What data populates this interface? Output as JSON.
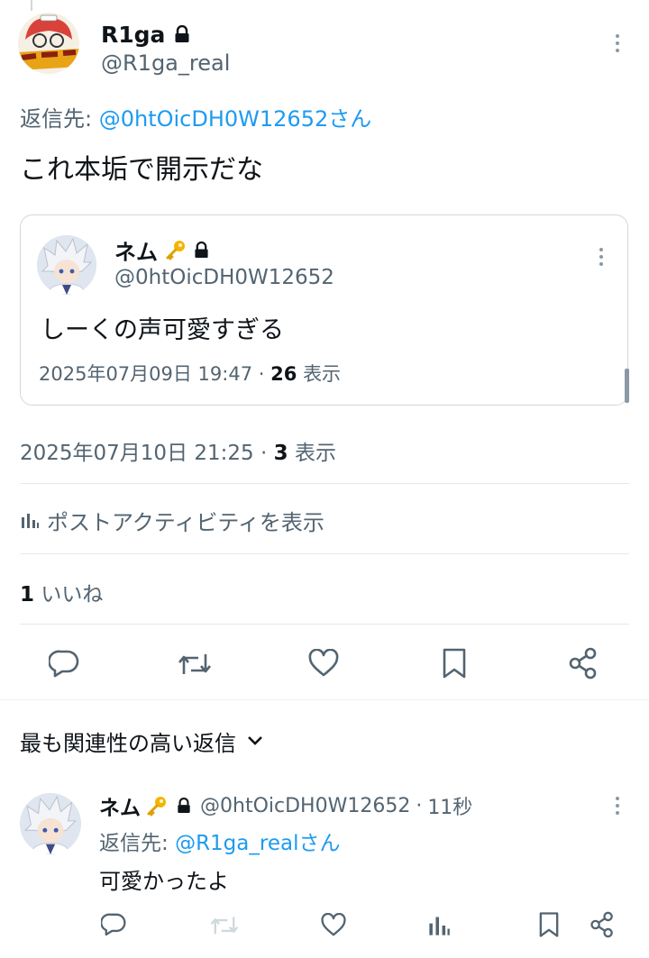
{
  "main_tweet": {
    "author_name": "R1ga",
    "author_handle": "@R1ga_real",
    "reply_prefix": "返信先: ",
    "reply_to": "@0htOicDH0W12652さん",
    "text": "これ本垢で開示だな",
    "timestamp": "2025年07月10日 21:25",
    "views_count": "3",
    "views_label": "表示"
  },
  "quoted_tweet": {
    "author_name": "ネム",
    "author_handle": "@0htOicDH0W12652",
    "text": "しーくの声可愛すぎる",
    "timestamp": "2025年07月09日 19:47",
    "views_count": "26",
    "views_label": "表示"
  },
  "activity_link": "ポストアクティビティを表示",
  "likes": {
    "count": "1",
    "label": "いいね"
  },
  "replies_sort": {
    "label": "最も関連性の高い返信"
  },
  "reply": {
    "author_name": "ネム",
    "author_handle": "@0htOicDH0W12652",
    "time_sep": "·",
    "time": "11秒",
    "reply_prefix": "返信先: ",
    "reply_to": "@R1ga_realさん",
    "text": "可愛かったよ"
  },
  "colors": {
    "link": "#1d9bf0",
    "muted": "#536471",
    "text": "#0f1419"
  },
  "icons": [
    "lock-icon",
    "key-icon",
    "more-icon",
    "reply-icon",
    "retweet-icon",
    "like-icon",
    "bookmark-icon",
    "share-icon",
    "analytics-icon",
    "chevron-down-icon"
  ]
}
